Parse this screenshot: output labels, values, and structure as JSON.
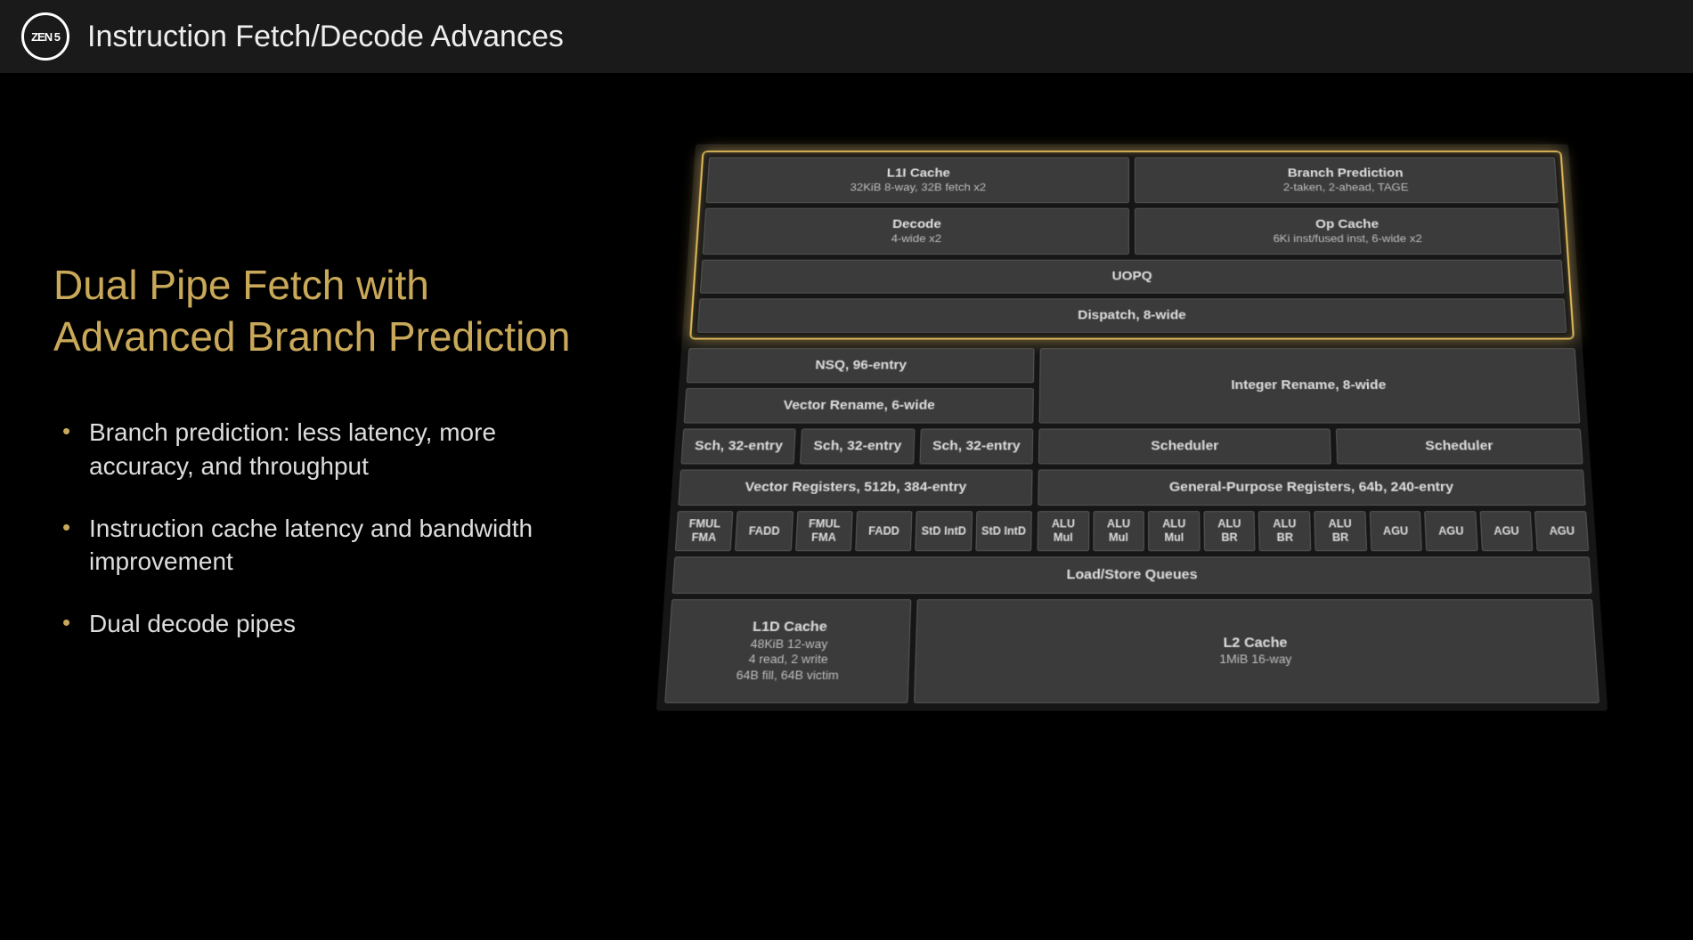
{
  "header": {
    "logo": "ZEN 5",
    "title": "Instruction Fetch/Decode Advances"
  },
  "heading": "Dual Pipe Fetch with Advanced Branch Prediction",
  "bullets": [
    "Branch prediction: less latency, more accuracy, and throughput",
    "Instruction cache latency and bandwidth improvement",
    "Dual decode pipes"
  ],
  "diagram": {
    "l1i": {
      "title": "L1I Cache",
      "sub": "32KiB 8-way, 32B fetch x2"
    },
    "bpred": {
      "title": "Branch Prediction",
      "sub": "2-taken, 2-ahead, TAGE"
    },
    "decode": {
      "title": "Decode",
      "sub": "4-wide x2"
    },
    "opcache": {
      "title": "Op Cache",
      "sub": "6Ki inst/fused inst, 6-wide x2"
    },
    "uopq": "UOPQ",
    "dispatch": "Dispatch, 8-wide",
    "nsq": "NSQ, 96-entry",
    "irename": "Integer Rename, 8-wide",
    "vrename": "Vector Rename, 6-wide",
    "sch": "Sch, 32-entry",
    "scheduler": "Scheduler",
    "vreg": "Vector Registers, 512b, 384-entry",
    "gpreg": "General-Purpose Registers, 64b, 240-entry",
    "vec_units": [
      "FMUL FMA",
      "FADD",
      "FMUL FMA",
      "FADD",
      "StD IntD",
      "StD IntD"
    ],
    "int_units": [
      "ALU Mul",
      "ALU Mul",
      "ALU Mul",
      "ALU BR",
      "ALU BR",
      "ALU BR",
      "AGU",
      "AGU",
      "AGU",
      "AGU"
    ],
    "lsq": "Load/Store Queues",
    "l1d": {
      "title": "L1D Cache",
      "sub1": "48KiB 12-way",
      "sub2": "4 read, 2 write",
      "sub3": "64B fill, 64B victim"
    },
    "l2": {
      "title": "L2 Cache",
      "sub": "1MiB 16-way"
    }
  }
}
